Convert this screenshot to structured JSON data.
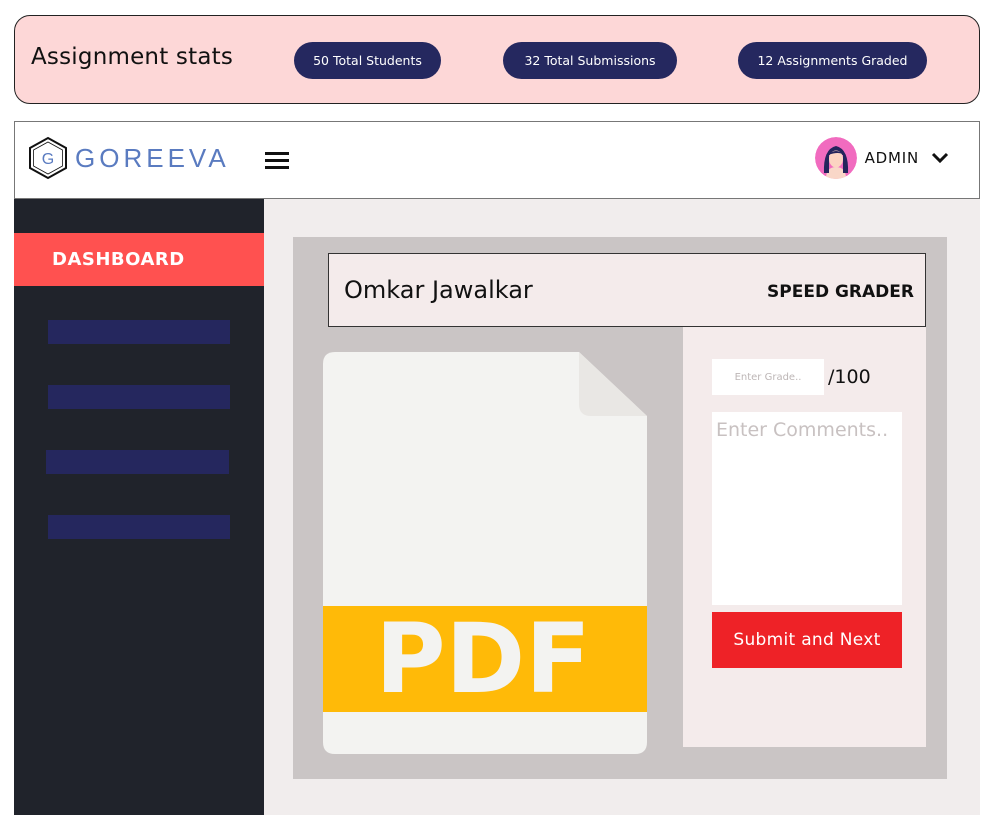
{
  "stats": {
    "title": "Assignment stats",
    "pills": [
      {
        "label": "50 Total Students"
      },
      {
        "label": "32 Total Submissions"
      },
      {
        "label": "12 Assignments Graded"
      }
    ]
  },
  "topbar": {
    "logo_letter": "G",
    "logo_text": "GOREEVA",
    "menu_icon": "hamburger-icon",
    "user": {
      "name": "ADMIN",
      "avatar_icon": "avatar-icon",
      "dropdown_icon": "chevron-down-icon"
    }
  },
  "sidebar": {
    "active_item": "DASHBOARD",
    "placeholder_count": 4
  },
  "grader": {
    "student_name": "Omkar Jawalkar",
    "mode_label": "SPEED GRADER",
    "file": {
      "type_label": "PDF",
      "icon": "pdf-file-icon"
    },
    "grade_placeholder": "Enter Grade..",
    "grade_max": "/100",
    "comments_placeholder": "Enter Comments..",
    "submit_label": "Submit and Next"
  },
  "colors": {
    "stats_bg": "#fdd7d7",
    "pill_bg": "#25285f",
    "sidebar_bg": "#20232b",
    "active_nav": "#ff5150",
    "submit_button": "#ee2227",
    "pdf_band": "#ffba08",
    "logo_text": "#5a7bc0"
  }
}
